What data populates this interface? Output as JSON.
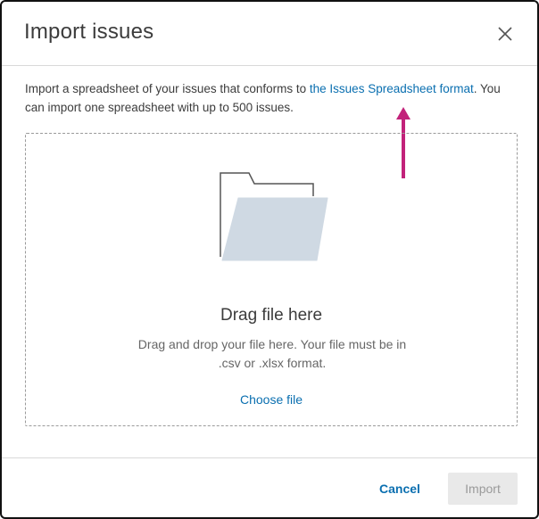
{
  "dialog": {
    "title": "Import issues",
    "close_icon": "close-icon"
  },
  "description": {
    "prefix": "Import a spreadsheet of your issues that conforms to ",
    "link_text": "the Issues Spreadsheet format",
    "suffix": ". You can import one spreadsheet with up to 500 issues."
  },
  "dropzone": {
    "icon": "folder-icon",
    "title": "Drag file here",
    "description": "Drag and drop your file here. Your file must be in .csv or .xlsx format.",
    "choose_label": "Choose file"
  },
  "footer": {
    "cancel_label": "Cancel",
    "import_label": "Import"
  },
  "colors": {
    "link": "#0a6fb0",
    "arrow": "#c2227a",
    "folder_fill": "#cfd9e3"
  }
}
